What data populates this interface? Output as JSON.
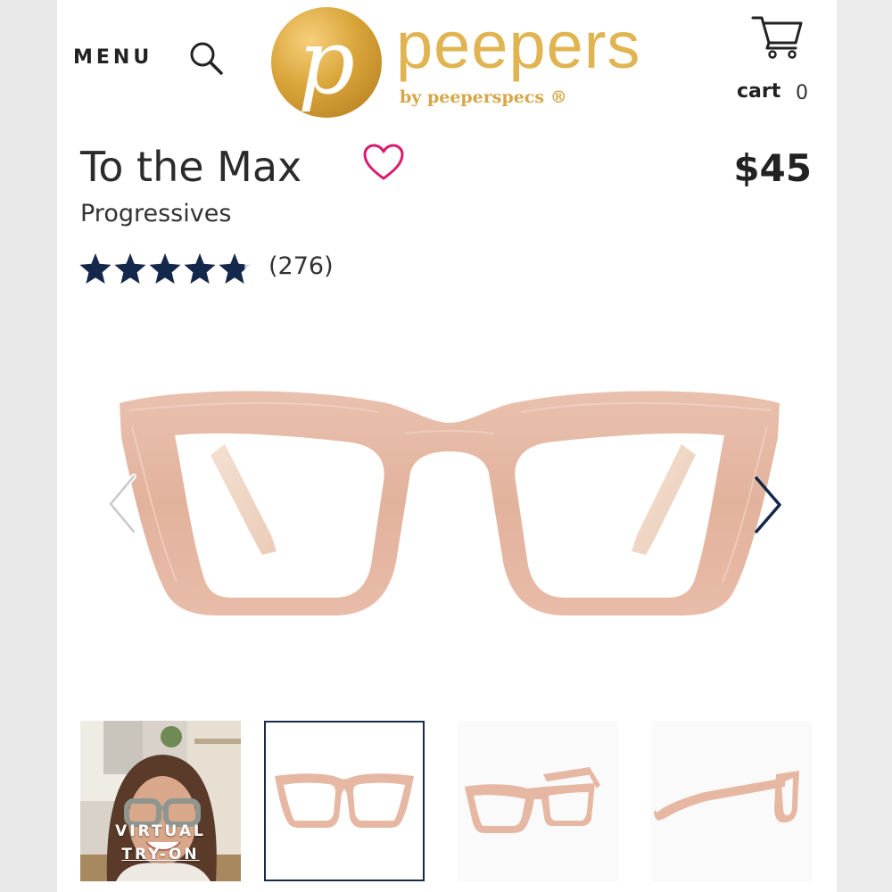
{
  "header": {
    "menu_label": "MENU",
    "logo_letter": "p",
    "logo_word": "peepers",
    "logo_sub": "by peeperspecs ®",
    "cart_label": "cart",
    "cart_count": "0"
  },
  "product": {
    "title": "To the Max",
    "category": "Progressives",
    "price": "$45",
    "rating": 4.8,
    "rating_max": 5,
    "reviews_count": "(276)",
    "frame_color": "#e7bba7",
    "star_color": "#14284b",
    "favorite_color": "#d81b6f"
  },
  "thumbnails": {
    "items": [
      {
        "label_line1": "VIRTUAL",
        "label_line2": "TRY-ON"
      },
      {
        "view": "front"
      },
      {
        "view": "angle"
      },
      {
        "view": "side"
      }
    ],
    "selected_index": 1
  }
}
